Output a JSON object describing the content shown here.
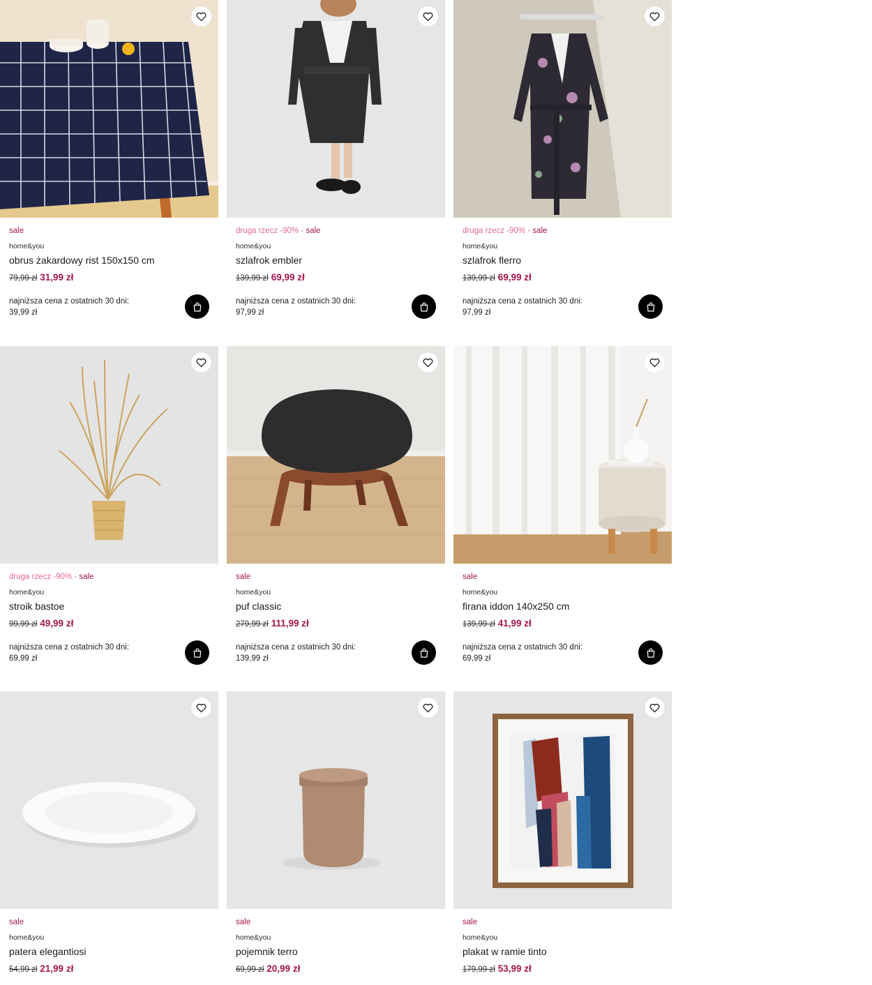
{
  "products": [
    {
      "tags": {
        "promo": "",
        "sep": "",
        "sale": "sale"
      },
      "brand": "home&you",
      "name": "obrus żakardowy rist 150x150 cm",
      "old_price": "79,99 zł",
      "new_price": "31,99 zł",
      "lowest_label": "najniższa cena z ostatnich 30 dni:",
      "lowest_value": "39,99 zł"
    },
    {
      "tags": {
        "promo": "druga rzecz -90%",
        "sep": " · ",
        "sale": "sale"
      },
      "brand": "home&you",
      "name": "szlafrok embler",
      "old_price": "139,99 zł",
      "new_price": "69,99 zł",
      "lowest_label": "najniższa cena z ostatnich 30 dni:",
      "lowest_value": "97,99 zł"
    },
    {
      "tags": {
        "promo": "druga rzecz -90%",
        "sep": " · ",
        "sale": "sale"
      },
      "brand": "home&you",
      "name": "szlafrok flerro",
      "old_price": "139,99 zł",
      "new_price": "69,99 zł",
      "lowest_label": "najniższa cena z ostatnich 30 dni:",
      "lowest_value": "97,99 zł"
    },
    {
      "tags": {
        "promo": "druga rzecz -90%",
        "sep": " · ",
        "sale": "sale"
      },
      "brand": "home&you",
      "name": "stroik bastoe",
      "old_price": "99,99 zł",
      "new_price": "49,99 zł",
      "lowest_label": "najniższa cena z ostatnich 30 dni:",
      "lowest_value": "69,99 zł"
    },
    {
      "tags": {
        "promo": "",
        "sep": "",
        "sale": "sale"
      },
      "brand": "home&you",
      "name": "puf classic",
      "old_price": "279,99 zł",
      "new_price": "111,99 zł",
      "lowest_label": "najniższa cena z ostatnich 30 dni:",
      "lowest_value": "139,99 zł"
    },
    {
      "tags": {
        "promo": "",
        "sep": "",
        "sale": "sale"
      },
      "brand": "home&you",
      "name": "firana iddon 140x250 cm",
      "old_price": "139,99 zł",
      "new_price": "41,99 zł",
      "lowest_label": "najniższa cena z ostatnich 30 dni:",
      "lowest_value": "69,99 zł"
    },
    {
      "tags": {
        "promo": "",
        "sep": "",
        "sale": "sale"
      },
      "brand": "home&you",
      "name": "patera elegantiosi",
      "old_price": "54,99 zł",
      "new_price": "21,99 zł"
    },
    {
      "tags": {
        "promo": "",
        "sep": "",
        "sale": "sale"
      },
      "brand": "home&you",
      "name": "pojemnik terro",
      "old_price": "69,99 zł",
      "new_price": "20,99 zł"
    },
    {
      "tags": {
        "promo": "",
        "sep": "",
        "sale": "sale"
      },
      "brand": "home&you",
      "name": "plakat w ramie tinto",
      "old_price": "179,99 zł",
      "new_price": "53,99 zł"
    }
  ],
  "colors": {
    "sale": "#a3164e",
    "promo": "#e26a93",
    "cart_button": "#000000"
  },
  "icons": {
    "favorite": "heart-icon",
    "cart": "shopping-bag-icon"
  }
}
